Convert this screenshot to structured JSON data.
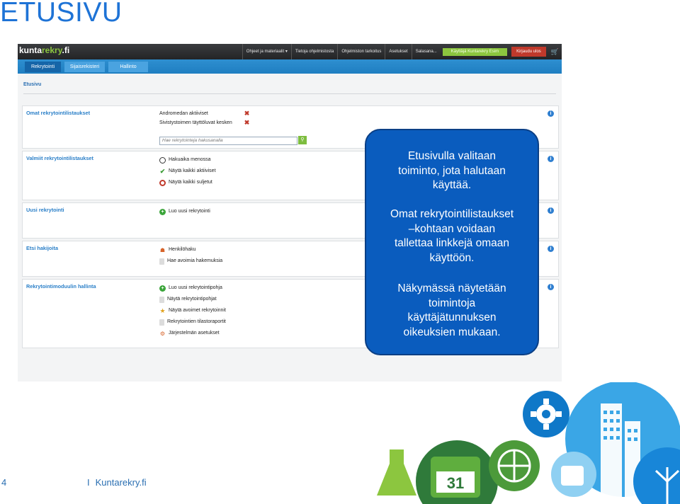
{
  "slide": {
    "title": "ETUSIVU",
    "page_number": "4",
    "footer_separator": "I",
    "footer_brand": "Kuntarekry.fi"
  },
  "app": {
    "logo_part1": "kunta",
    "logo_part2": "rekry",
    "logo_part3": ".fi",
    "top_menu": [
      "Ohjeet ja materiaalit ▾",
      "Tietoja ohjelmistosta",
      "Ohjelmiston tarkoitus",
      "Asetukset",
      "Salasana..."
    ],
    "user_label": "Käyttäjä Kuntarekry Esim",
    "logout_label": "Kirjaudu ulos",
    "cart_icon": "cart-icon",
    "nav_tabs": [
      "Rekrytointi",
      "Sijaisrekisteri",
      "Hallinto"
    ],
    "active_tab": "Rekrytointi",
    "breadcrumb": "Etusivu",
    "colors": {
      "brand_blue": "#1f7ec1",
      "accent_green": "#8cc63f",
      "callout_blue": "#0a5cbe",
      "title_blue": "#1e73d6"
    }
  },
  "panels": {
    "omat": {
      "title": "Omat rekrytointilistaukset",
      "items": [
        "Andromedan aktiiviset",
        "Sivistystoimen täyttöluvat kesken"
      ],
      "search_placeholder": "Hae rekrytointeja hakusanalla"
    },
    "valmiit": {
      "title": "Valmiit rekrytointilistaukset",
      "items": [
        "Hakuaika menossa",
        "Näytä kaikki aktiiviset",
        "Näytä kaikki suljetut"
      ]
    },
    "uusi": {
      "title": "Uusi rekrytointi",
      "items": [
        "Luo uusi rekrytointi"
      ]
    },
    "etsi": {
      "title": "Etsi hakijoita",
      "items": [
        "Henkilöhaku",
        "Hae avoimia hakemuksia"
      ]
    },
    "hallinta": {
      "title": "Rekrytointimoduulin hallinta",
      "items": [
        "Luo uusi rekrytointipohja",
        "Näytä rekrytointipohjat",
        "Näytä avoimet rekrytoinnit",
        "Rekrytointien tilastoraportit",
        "Järjestelmän asetukset"
      ]
    }
  },
  "callout": {
    "p1": "Etusivulla valitaan\ntoiminto, jota halutaan\nkäyttää.",
    "p2": "Omat rekrytointilistaukset\n–kohtaan voidaan\ntallettaa linkkejä omaan\nkäyttöön.",
    "p3": "Näkymässä näytetään\ntoimintoja\nkäyttäjätunnuksen\noikeuksien mukaan."
  }
}
